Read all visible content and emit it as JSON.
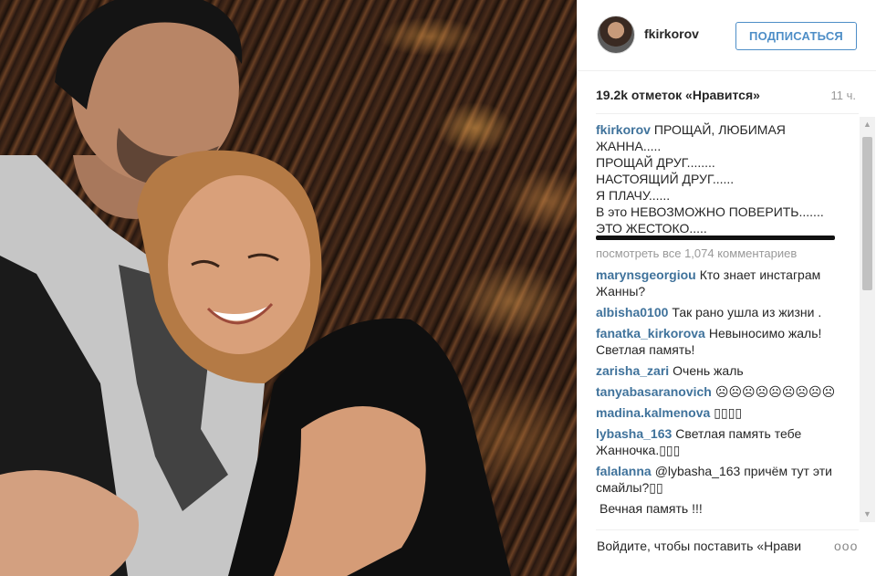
{
  "header": {
    "username": "fkirkorov",
    "follow_label": "ПОДПИСАТЬСЯ"
  },
  "stats": {
    "likes": "19.2k отметок «Нравится»",
    "time_ago": "11 ч."
  },
  "caption": {
    "username": "fkirkorov",
    "lines": [
      "ПРОЩАЙ, ЛЮБИМАЯ",
      "ЖАННА.....",
      "ПРОЩАЙ ДРУГ........",
      "НАСТОЯЩИЙ ДРУГ......",
      "Я ПЛАЧУ......",
      "В это НЕВОЗМОЖНО ПОВЕРИТЬ.......",
      "ЭТО ЖЕСТОКО....."
    ]
  },
  "view_all_label": "посмотреть все 1,074 комментариев",
  "comments": [
    {
      "user": "marynsgeorgiou",
      "text": "Кто знает инстаграм Жанны?"
    },
    {
      "user": "albisha0100",
      "text": "Так рано ушла из жизни ."
    },
    {
      "user": "fanatka_kirkorova",
      "text": "Невыносимо жаль! Светлая память!"
    },
    {
      "user": "zarisha_zari",
      "text": "Очень жаль"
    },
    {
      "user": "tanyabasaranovich",
      "text": "☹☹☹☹☹☹☹☹☹"
    },
    {
      "user": "madina.kalmenova",
      "text": "▯▯▯▯"
    },
    {
      "user": "lybasha_163",
      "text": "Светлая память тебе Жанночка.▯▯▯"
    },
    {
      "user": "falalanna",
      "text": "@lybasha_163 причём тут эти смайлы?▯▯"
    },
    {
      "user": "",
      "text": "Вечная память !!!"
    }
  ],
  "footer": {
    "login_text": "Войдите",
    "login_rest": ", чтобы поставить «Нрави",
    "more": "ооо"
  },
  "colors": {
    "username": "#3f729b",
    "follow_border": "#4e8ec7",
    "muted": "#999999"
  }
}
